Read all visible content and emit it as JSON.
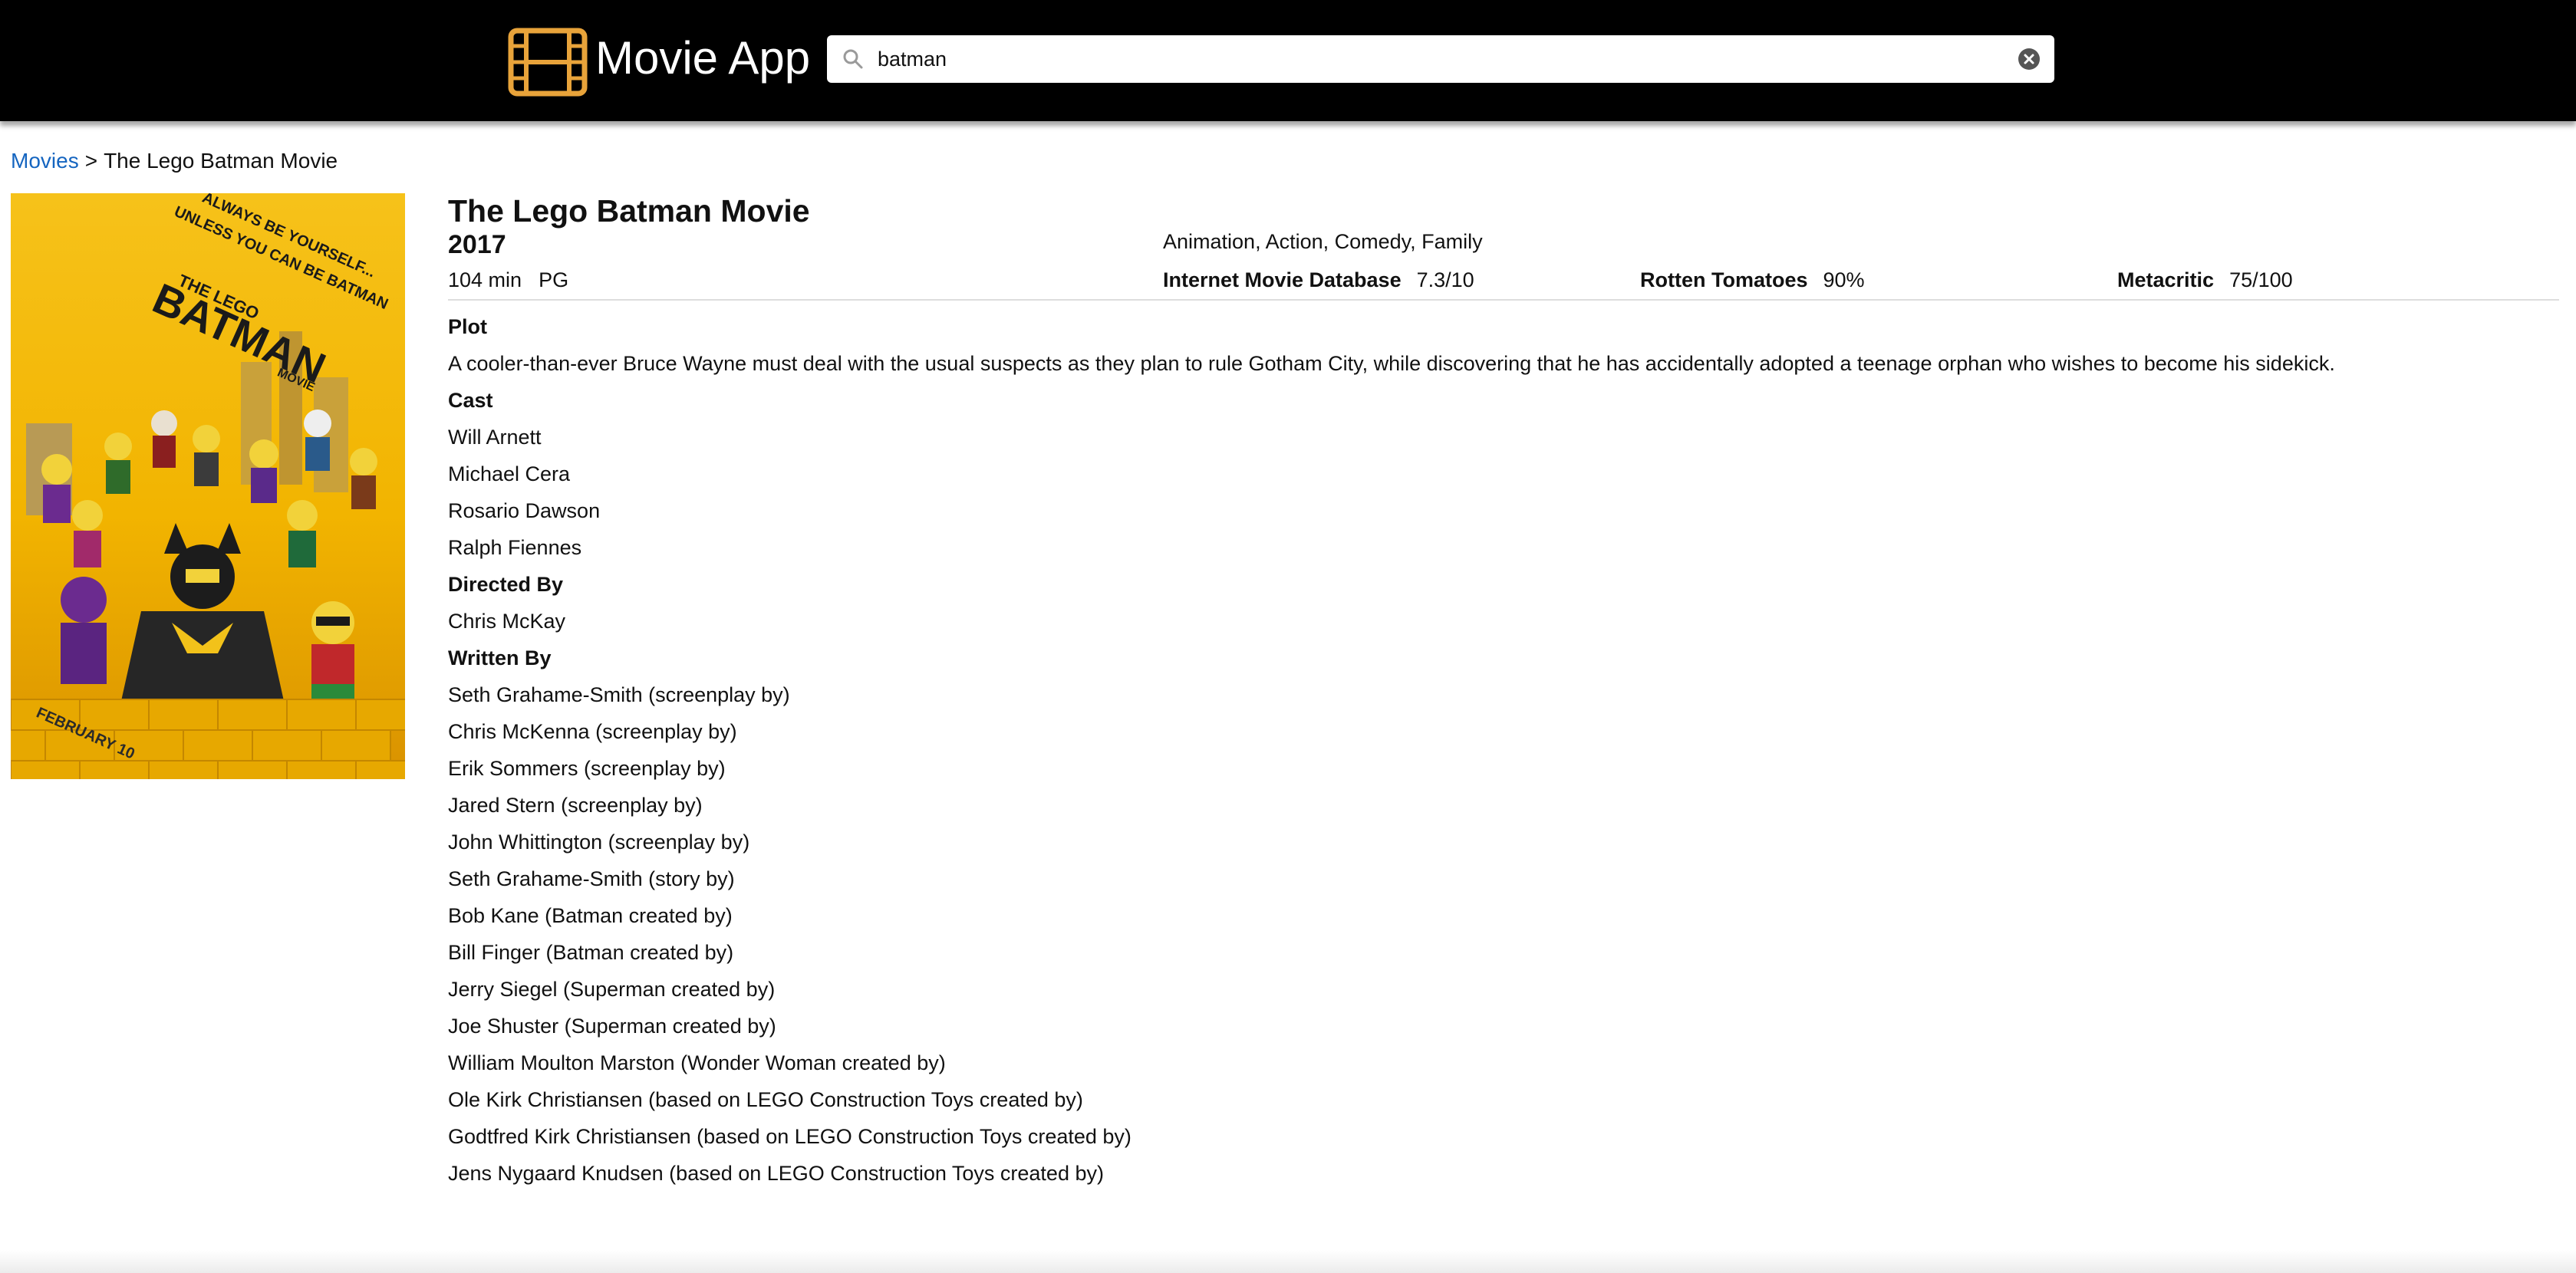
{
  "header": {
    "app_title": "Movie App",
    "logo_icon": "film-strip-icon",
    "brand_color": "#e8a33a",
    "search": {
      "value": "batman",
      "icon": "search-icon",
      "clear_icon": "clear-icon"
    }
  },
  "breadcrumb": {
    "root": "Movies",
    "separator": ">",
    "current": "The Lego Batman Movie"
  },
  "poster": {
    "tagline_line1": "ALWAYS BE YOURSELF...",
    "tagline_line2": "UNLESS YOU CAN BE BATMAN",
    "brand": "THE LEGO",
    "title": "BATMAN",
    "subtitle": "MOVIE",
    "release": "FEBRUARY 10"
  },
  "movie": {
    "title": "The Lego Batman Movie",
    "year": "2017",
    "runtime": "104 min",
    "rated": "PG",
    "genres": "Animation, Action, Comedy, Family",
    "ratings": [
      {
        "source": "Internet Movie Database",
        "value": "7.3/10"
      },
      {
        "source": "Rotten Tomatoes",
        "value": "90%"
      },
      {
        "source": "Metacritic",
        "value": "75/100"
      }
    ],
    "plot_label": "Plot",
    "plot": "A cooler-than-ever Bruce Wayne must deal with the usual suspects as they plan to rule Gotham City, while discovering that he has accidentally adopted a teenage orphan who wishes to become his sidekick.",
    "cast_label": "Cast",
    "cast": [
      "Will Arnett",
      "Michael Cera",
      "Rosario Dawson",
      "Ralph Fiennes"
    ],
    "directed_label": "Directed By",
    "directors": [
      "Chris McKay"
    ],
    "written_label": "Written By",
    "writers": [
      "Seth Grahame-Smith (screenplay by)",
      "Chris McKenna (screenplay by)",
      "Erik Sommers (screenplay by)",
      "Jared Stern (screenplay by)",
      "John Whittington (screenplay by)",
      "Seth Grahame-Smith (story by)",
      "Bob Kane (Batman created by)",
      "Bill Finger (Batman created by)",
      "Jerry Siegel (Superman created by)",
      "Joe Shuster (Superman created by)",
      "William Moulton Marston (Wonder Woman created by)",
      "Ole Kirk Christiansen (based on LEGO Construction Toys created by)",
      "Godtfred Kirk Christiansen (based on LEGO Construction Toys created by)",
      "Jens Nygaard Knudsen (based on LEGO Construction Toys created by)"
    ]
  }
}
